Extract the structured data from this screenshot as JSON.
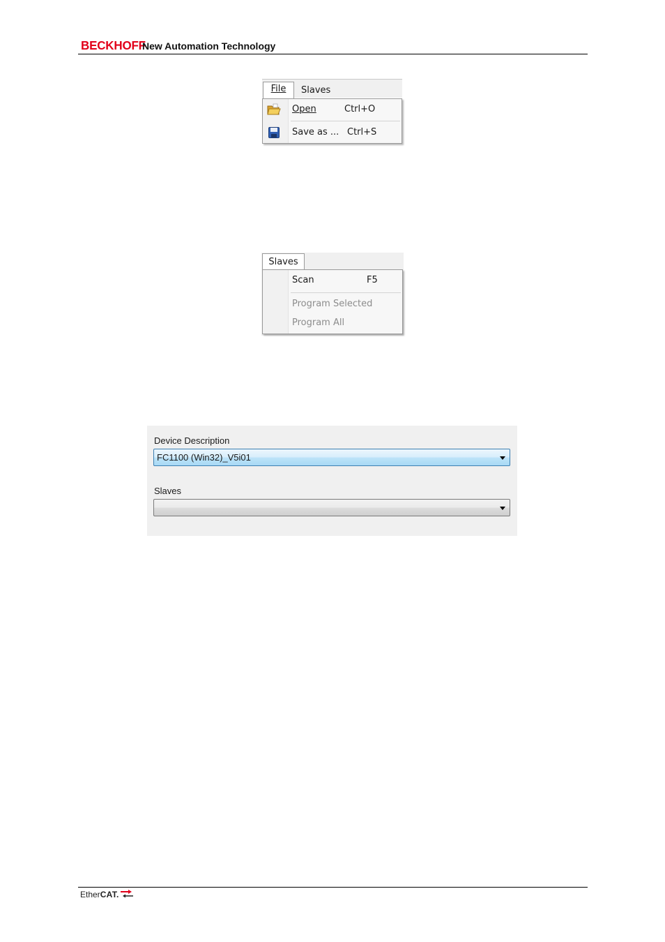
{
  "header": {
    "brand": "BECKHOFF",
    "tagline": "New Automation Technology"
  },
  "file_menu_screenshot": {
    "menubar": [
      "File",
      "Slaves"
    ],
    "items": [
      {
        "label": "Open",
        "shortcut": "Ctrl+O",
        "icon": "open-folder-icon"
      },
      {
        "label": "Save as ...",
        "shortcut": "Ctrl+S",
        "icon": "save-disk-icon"
      }
    ]
  },
  "slaves_menu_screenshot": {
    "menubar": [
      "Slaves"
    ],
    "items": [
      {
        "label": "Scan",
        "shortcut": "F5",
        "enabled": true
      },
      {
        "label": "Program Selected",
        "enabled": false
      },
      {
        "label": "Program All",
        "enabled": false
      }
    ]
  },
  "device_panel_screenshot": {
    "device_description_label": "Device Description",
    "device_description_value": "FC1100 (Win32)_V5i01",
    "slaves_label": "Slaves",
    "slaves_value": ""
  },
  "footer": {
    "logo_prefix": "Ether",
    "logo_suffix": "CAT."
  },
  "colors": {
    "brand_red": "#e2001a",
    "selected_combo_border": "#3c7fb1"
  }
}
